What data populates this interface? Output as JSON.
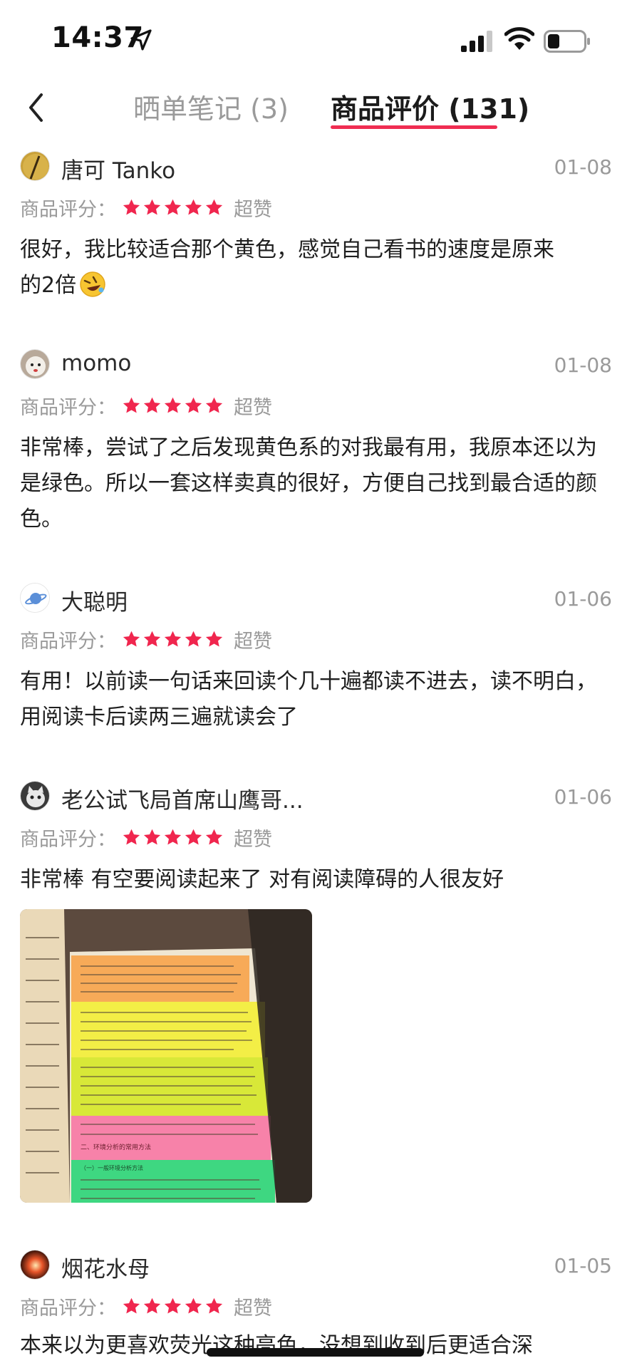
{
  "status_bar": {
    "time": "14:37"
  },
  "header": {
    "tabs": [
      {
        "label": "晒单笔记 (3)",
        "active": false
      },
      {
        "label": "商品评价 (131)",
        "active": true
      }
    ],
    "accent_color": "#f02d52"
  },
  "rating_label": "商品评分：",
  "reviews": [
    {
      "user": "唐可 Tanko",
      "date": "01-08",
      "stars": 5,
      "rating_word": "超赞",
      "text_line1": "很好，我比较适合那个黄色，感觉自己看书的速度是原来",
      "text_line2": "的2倍"
    },
    {
      "user": "momo",
      "date": "01-08",
      "stars": 5,
      "rating_word": "超赞",
      "text": "非常棒，尝试了之后发现黄色系的对我最有用，我原本还以为是绿色。所以一套这样卖真的很好，方便自己找到最合适的颜色。"
    },
    {
      "user": "大聪明",
      "date": "01-06",
      "stars": 5,
      "rating_word": "超赞",
      "text": "有用！以前读一句话来回读个几十遍都读不进去，读不明白，用阅读卡后读两三遍就读会了"
    },
    {
      "user": "老公试飞局首席山鹰哥...",
      "date": "01-06",
      "stars": 5,
      "rating_word": "超赞",
      "text": "非常棒 有空要阅读起来了 对有阅读障碍的人很友好",
      "photo": {
        "heading": "二、环境分析的常用方法",
        "subheading": "（一）一般环境分析方法"
      }
    },
    {
      "user": "烟花水母",
      "date": "01-05",
      "stars": 5,
      "rating_word": "超赞",
      "text": "本来以为更喜欢荧光这种亮色，没想到收到后更适合深"
    }
  ]
}
